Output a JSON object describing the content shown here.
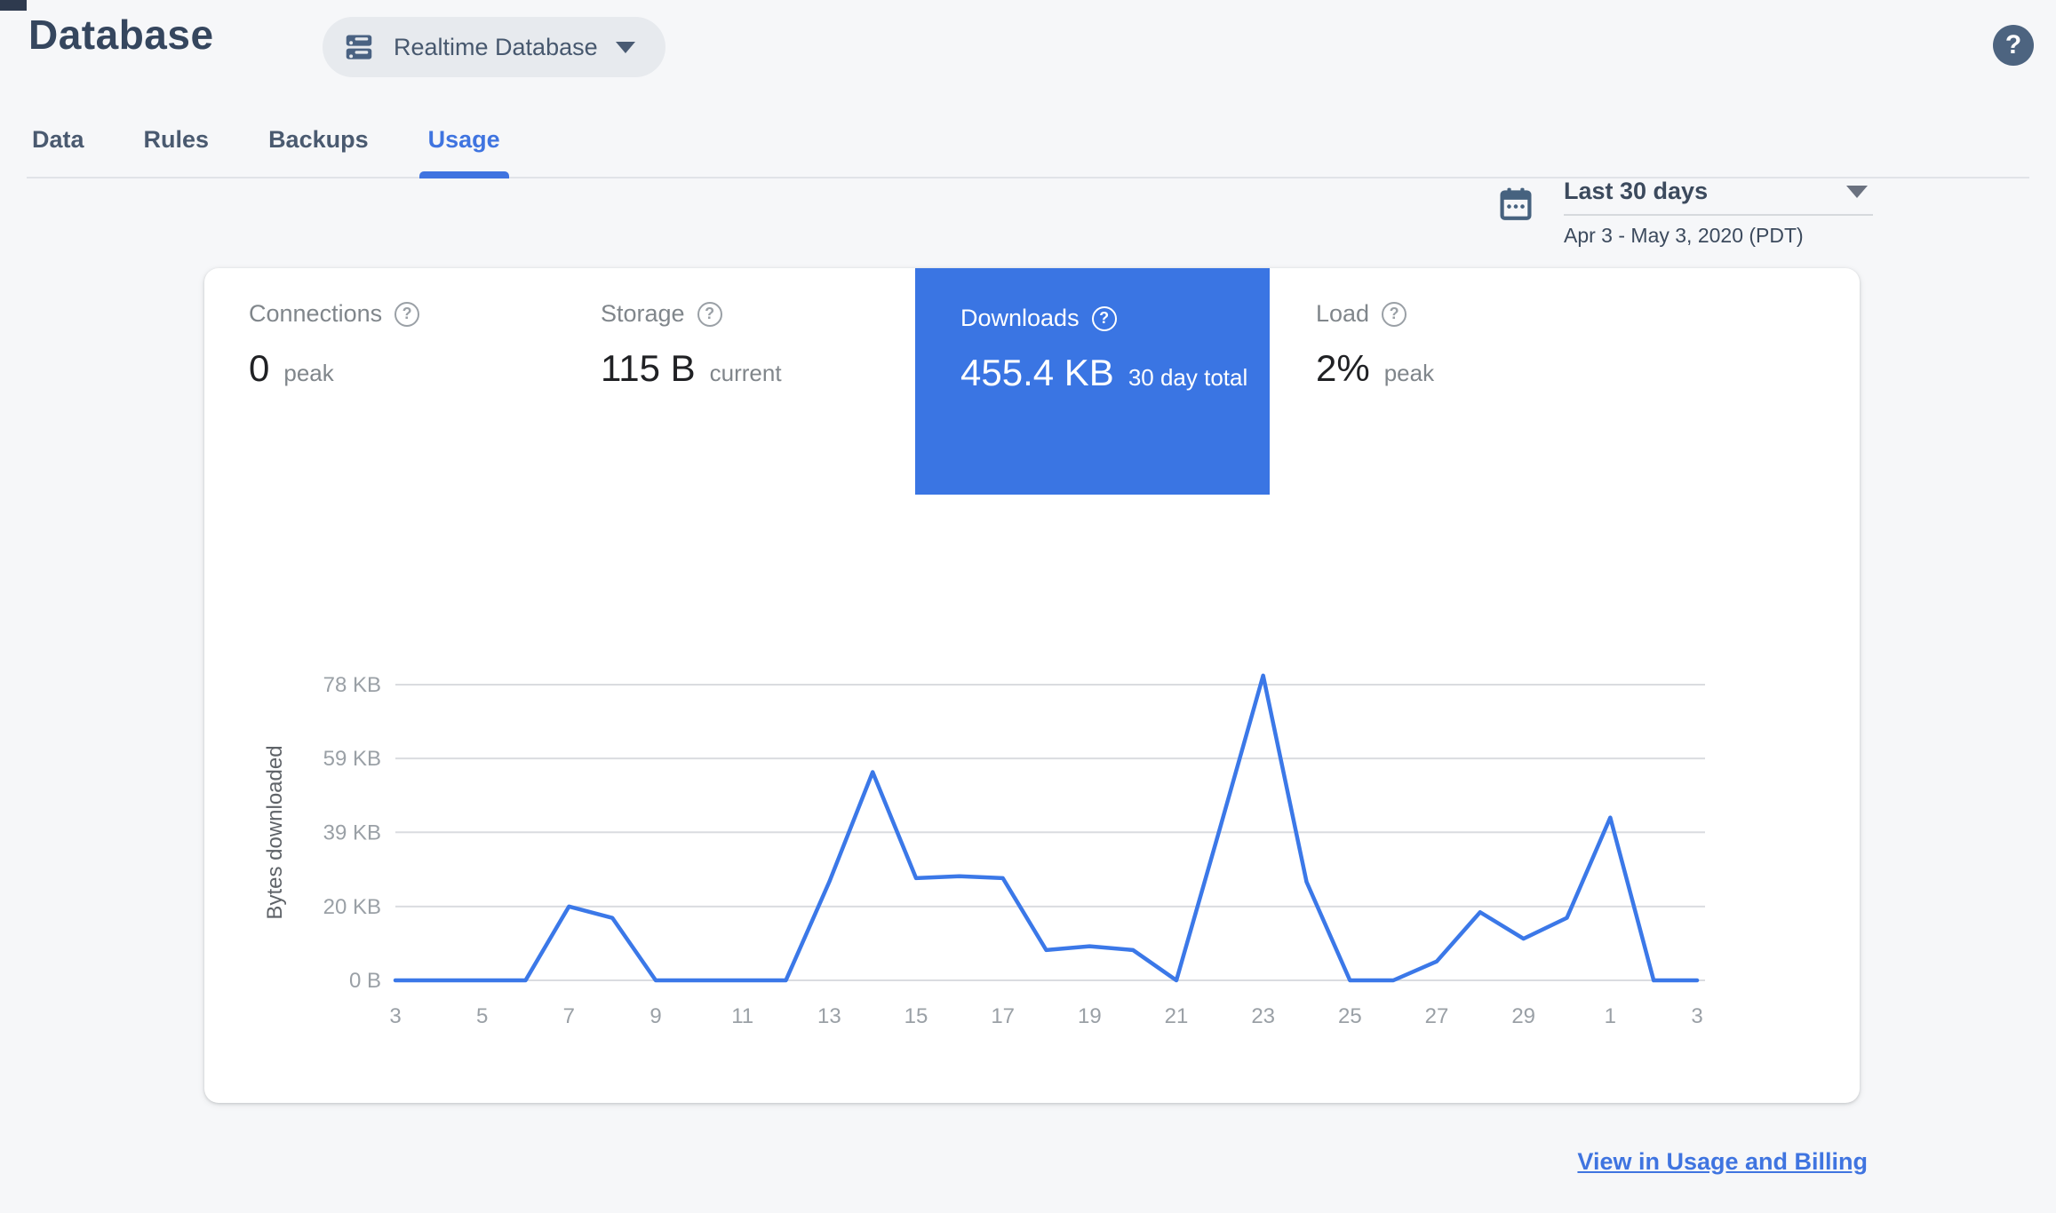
{
  "header": {
    "title": "Database",
    "database_selector": "Realtime Database",
    "help_glyph": "?"
  },
  "icons": {
    "help": "?"
  },
  "tabs": [
    {
      "label": "Data",
      "active": false
    },
    {
      "label": "Rules",
      "active": false
    },
    {
      "label": "Backups",
      "active": false
    },
    {
      "label": "Usage",
      "active": true
    }
  ],
  "date_range": {
    "preset": "Last 30 days",
    "detail": "Apr 3 - May 3, 2020 (PDT)"
  },
  "metrics": {
    "connections": {
      "label": "Connections",
      "value": "0",
      "unit": "peak"
    },
    "storage": {
      "label": "Storage",
      "value": "115 B",
      "unit": "current"
    },
    "downloads": {
      "label": "Downloads",
      "value": "455.4 KB",
      "unit": "30 day total",
      "selected": true
    },
    "load": {
      "label": "Load",
      "value": "2%",
      "unit": "peak"
    }
  },
  "footer": {
    "link": "View in Usage and Billing"
  },
  "colors": {
    "accent_blue": "#3f74e0",
    "tile_blue": "#3a75e3",
    "line_blue": "#3b78e8",
    "grid_gray": "#dadce0",
    "tick_gray": "#9aa0a6",
    "title_slate": "#35465e",
    "help_circle": "#4d6480"
  },
  "chart_data": {
    "type": "line",
    "title": "Downloads",
    "ylabel": "Bytes downloaded",
    "xlabel": "",
    "x_days": [
      3,
      4,
      5,
      6,
      7,
      8,
      9,
      10,
      11,
      12,
      13,
      14,
      15,
      16,
      17,
      18,
      19,
      20,
      21,
      22,
      23,
      24,
      25,
      26,
      27,
      28,
      29,
      30,
      1,
      2,
      3
    ],
    "x_tick_labels": [
      "3",
      "5",
      "7",
      "9",
      "11",
      "13",
      "15",
      "17",
      "19",
      "21",
      "23",
      "25",
      "27",
      "29",
      "1",
      "3"
    ],
    "values_kb": [
      0,
      0,
      0,
      0,
      19.5,
      16.5,
      0,
      0,
      0,
      0,
      26,
      55,
      27,
      27.5,
      27,
      8,
      9,
      8,
      0,
      40,
      80.5,
      26,
      0,
      0,
      5,
      18,
      11,
      16.5,
      43,
      0,
      0
    ],
    "y_ticks": [
      {
        "label": "0 B",
        "kb": 0
      },
      {
        "label": "20 KB",
        "kb": 19.5
      },
      {
        "label": "39 KB",
        "kb": 39.1
      },
      {
        "label": "59 KB",
        "kb": 58.6
      },
      {
        "label": "78 KB",
        "kb": 78.1
      }
    ],
    "ylim_kb": [
      0,
      78.1
    ],
    "grid": true,
    "legend": "none",
    "line_color": "#3b78e8"
  }
}
